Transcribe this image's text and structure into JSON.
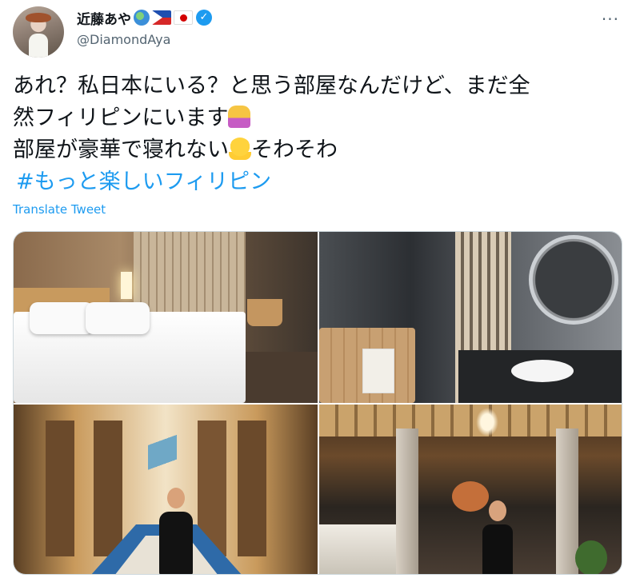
{
  "author": {
    "display_name": "近藤あや",
    "handle": "@DiamondAya",
    "badges": [
      "globe-emoji",
      "philippines-flag",
      "japan-flag",
      "verified-badge"
    ]
  },
  "more_menu_label": "···",
  "tweet": {
    "line1": "あれ？私日本にいる？と思う部屋なんだけど、まだ全",
    "line2": "然フィリピンにいます",
    "line2_emoji": "person-raising-hand-emoji",
    "line3a": "部屋が豪華で寝れない",
    "line3_emoji": "melting-face-emoji",
    "line3b": "そわそわ",
    "hashtag": "#もっと楽しいフィリピン"
  },
  "translate_label": "Translate Tweet",
  "photos": [
    {
      "subject": "hotel-bedroom"
    },
    {
      "subject": "hotel-bathroom"
    },
    {
      "subject": "hallway-woman"
    },
    {
      "subject": "lobby-woman"
    }
  ],
  "colors": {
    "link": "#1d9bf0",
    "text": "#0f1419",
    "muted": "#536471",
    "border": "#cfd9de"
  }
}
